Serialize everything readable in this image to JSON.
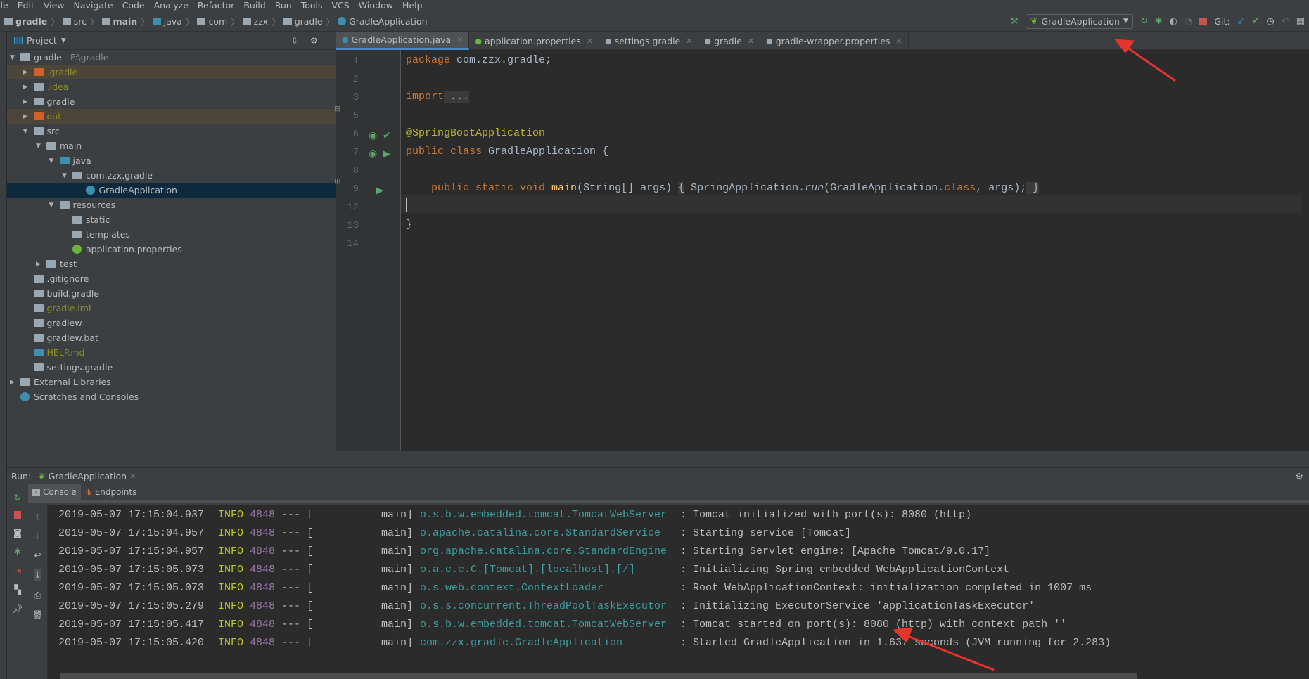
{
  "menu": [
    "ile",
    "Edit",
    "View",
    "Navigate",
    "Code",
    "Analyze",
    "Refactor",
    "Build",
    "Run",
    "Tools",
    "VCS",
    "Window",
    "Help"
  ],
  "breadcrumb": [
    "gradle",
    "src",
    "main",
    "java",
    "com",
    "zzx",
    "gradle",
    "GradleApplication"
  ],
  "toolbar": {
    "run_config": "GradleApplication",
    "git_label": "Git:"
  },
  "project": {
    "title": "Project",
    "tree": [
      {
        "label": "gradle",
        "suffix": "F:\\gradle",
        "depth": 0,
        "arrow": "down",
        "icon": "module-folder"
      },
      {
        "label": ".gradle",
        "depth": 1,
        "arrow": "right",
        "icon": "excluded-folder",
        "excluded": true
      },
      {
        "label": ".idea",
        "depth": 1,
        "arrow": "right",
        "icon": "folder",
        "olive": true
      },
      {
        "label": "gradle",
        "depth": 1,
        "arrow": "right",
        "icon": "folder"
      },
      {
        "label": "out",
        "depth": 1,
        "arrow": "right",
        "icon": "excluded-folder",
        "excluded": true
      },
      {
        "label": "src",
        "depth": 1,
        "arrow": "down",
        "icon": "folder"
      },
      {
        "label": "main",
        "depth": 2,
        "arrow": "down",
        "icon": "module-folder"
      },
      {
        "label": "java",
        "depth": 3,
        "arrow": "down",
        "icon": "source-folder"
      },
      {
        "label": "com.zzx.gradle",
        "depth": 4,
        "arrow": "down",
        "icon": "package"
      },
      {
        "label": "GradleApplication",
        "depth": 5,
        "icon": "spring-class",
        "selected": true
      },
      {
        "label": "resources",
        "depth": 3,
        "arrow": "down",
        "icon": "resources-folder"
      },
      {
        "label": "static",
        "depth": 4,
        "icon": "package"
      },
      {
        "label": "templates",
        "depth": 4,
        "icon": "package"
      },
      {
        "label": "application.properties",
        "depth": 4,
        "icon": "spring-properties"
      },
      {
        "label": "test",
        "depth": 2,
        "arrow": "right",
        "icon": "module-folder"
      },
      {
        "label": ".gitignore",
        "depth": 1,
        "icon": "file"
      },
      {
        "label": "build.gradle",
        "depth": 1,
        "icon": "gradle-file"
      },
      {
        "label": "gradle.iml",
        "depth": 1,
        "icon": "file",
        "olive": true
      },
      {
        "label": "gradlew",
        "depth": 1,
        "icon": "file"
      },
      {
        "label": "gradlew.bat",
        "depth": 1,
        "icon": "file"
      },
      {
        "label": "HELP.md",
        "depth": 1,
        "icon": "markdown-file",
        "olive": true
      },
      {
        "label": "settings.gradle",
        "depth": 1,
        "icon": "gradle-file"
      },
      {
        "label": "External Libraries",
        "depth": 0,
        "arrow": "right",
        "icon": "libraries"
      },
      {
        "label": "Scratches and Consoles",
        "depth": 0,
        "icon": "scratches"
      }
    ]
  },
  "tabs": [
    {
      "label": "GradleApplication.java",
      "active": true
    },
    {
      "label": "application.properties"
    },
    {
      "label": "settings.gradle"
    },
    {
      "label": "gradle"
    },
    {
      "label": "gradle-wrapper.properties"
    }
  ],
  "editor": {
    "line_numbers": [
      "1",
      "2",
      "3",
      "5",
      "6",
      "7",
      "8",
      "9",
      "12",
      "13",
      "14"
    ],
    "lines": {
      "l1_kw": "package",
      "l1_rest": " com.zzx.gradle;",
      "l3_kw": "import",
      "l3_fold": " ...",
      "l6_ann": "@SpringBootApplication",
      "l7_kw": "public class",
      "l7_rest": " GradleApplication {",
      "l9_kw": "public static void",
      "l9_fn": "main",
      "l9_args": "(String[] args) ",
      "l9_b1": "{",
      "l9_body1": " SpringApplication.",
      "l9_run": "run",
      "l9_body2": "(GradleApplication.",
      "l9_class": "class",
      "l9_body3": ", args);",
      "l9_b2": " }",
      "l13": "}"
    }
  },
  "run": {
    "label": "Run:",
    "config": "GradleApplication",
    "tabs": [
      "Console",
      "Endpoints"
    ]
  },
  "console": {
    "logs": [
      {
        "ts": "2019-05-07 17:15:04.937",
        "level": "INFO",
        "pid": "4848",
        "sep": "--- [",
        "thread": "main]",
        "logger": "o.s.b.w.embedded.tomcat.TomcatWebServer",
        "msg": ": Tomcat initialized with port(s): 8080 (http)"
      },
      {
        "ts": "2019-05-07 17:15:04.957",
        "level": "INFO",
        "pid": "4848",
        "sep": "--- [",
        "thread": "main]",
        "logger": "o.apache.catalina.core.StandardService",
        "msg": ": Starting service [Tomcat]"
      },
      {
        "ts": "2019-05-07 17:15:04.957",
        "level": "INFO",
        "pid": "4848",
        "sep": "--- [",
        "thread": "main]",
        "logger": "org.apache.catalina.core.StandardEngine",
        "msg": ": Starting Servlet engine: [Apache Tomcat/9.0.17]"
      },
      {
        "ts": "2019-05-07 17:15:05.073",
        "level": "INFO",
        "pid": "4848",
        "sep": "--- [",
        "thread": "main]",
        "logger": "o.a.c.c.C.[Tomcat].[localhost].[/]",
        "msg": ": Initializing Spring embedded WebApplicationContext"
      },
      {
        "ts": "2019-05-07 17:15:05.073",
        "level": "INFO",
        "pid": "4848",
        "sep": "--- [",
        "thread": "main]",
        "logger": "o.s.web.context.ContextLoader",
        "msg": ": Root WebApplicationContext: initialization completed in 1007 ms"
      },
      {
        "ts": "2019-05-07 17:15:05.279",
        "level": "INFO",
        "pid": "4848",
        "sep": "--- [",
        "thread": "main]",
        "logger": "o.s.s.concurrent.ThreadPoolTaskExecutor",
        "msg": ": Initializing ExecutorService 'applicationTaskExecutor'"
      },
      {
        "ts": "2019-05-07 17:15:05.417",
        "level": "INFO",
        "pid": "4848",
        "sep": "--- [",
        "thread": "main]",
        "logger": "o.s.b.w.embedded.tomcat.TomcatWebServer",
        "msg": ": Tomcat started on port(s): 8080 (http) with context path ''"
      },
      {
        "ts": "2019-05-07 17:15:05.420",
        "level": "INFO",
        "pid": "4848",
        "sep": "--- [",
        "thread": "main]",
        "logger": "com.zzx.gradle.GradleApplication",
        "msg": ": Started GradleApplication in 1.637 seconds (JVM running for 2.283)"
      }
    ]
  },
  "colors": {
    "keyword": "#cc7832",
    "annotation": "#bbb529",
    "logger": "#3a9f9f",
    "info": "#b9c91e",
    "pid": "#9876aa",
    "selection": "#0d293e",
    "annotation_arrow": "#e8322c"
  }
}
